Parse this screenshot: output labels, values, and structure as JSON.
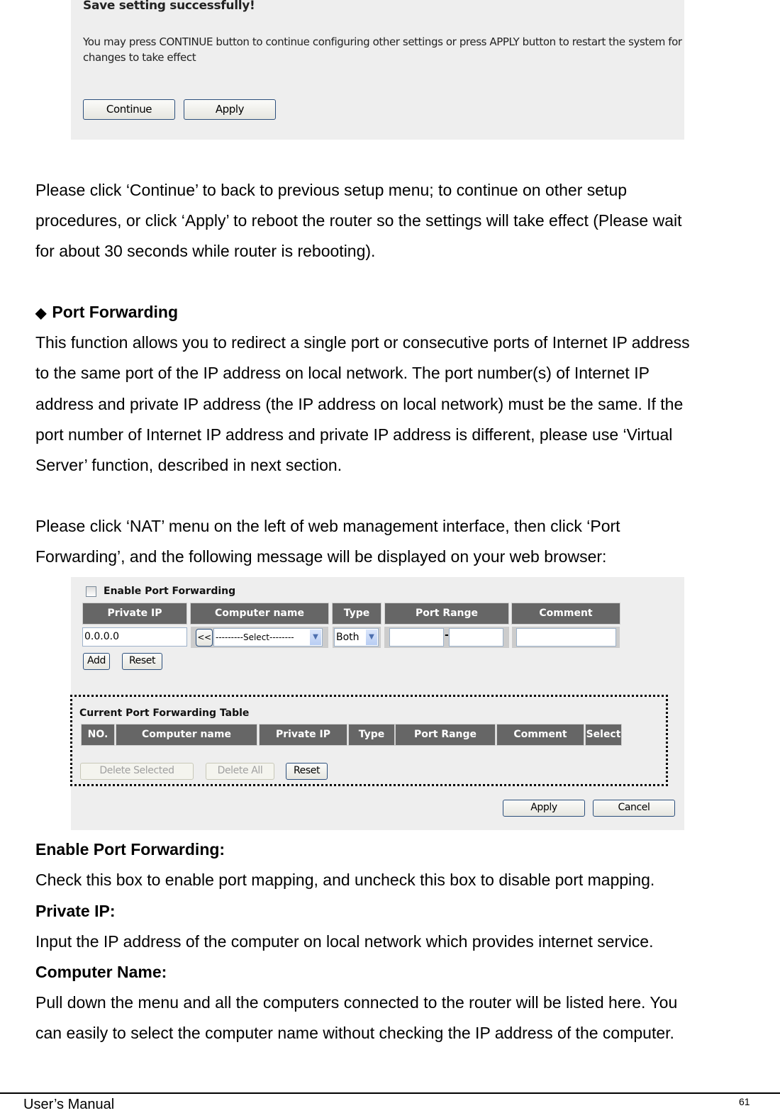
{
  "save_dialog": {
    "title": "Save setting successfully!",
    "message": "You may press CONTINUE button to continue configuring other settings or press APPLY button to restart the system for changes to take effect",
    "continue_label": "Continue",
    "apply_label": "Apply"
  },
  "paragraphs": {
    "continue_note": [
      "Please click ‘Continue’ to back to previous setup menu; to continue on other setup",
      "procedures, or click ‘Apply’ to reboot the router so the settings will take effect (Please wait",
      "for about 30 seconds while router is rebooting)."
    ],
    "section_title": "Port Forwarding",
    "section_bullet": "◆",
    "intro": [
      "This function allows you to redirect a single port or consecutive ports of Internet IP address",
      "to the same port of the IP address on local network. The port number(s) of Internet IP",
      "address and private IP address (the IP address on local network) must be the same. If the",
      "port number of Internet IP address and private IP address is different, please use ‘Virtual",
      "Server’ function, described in next section."
    ],
    "nav_instruction": [
      "Please click ‘NAT’ menu on the left of web management interface, then click ‘Port",
      "Forwarding’, and the following message will be displayed on your web browser:"
    ]
  },
  "port_forwarding_form": {
    "enable_label": "Enable Port Forwarding",
    "enable_checked": false,
    "headers": [
      "Private IP",
      "Computer name",
      "Type",
      "Port Range",
      "Comment"
    ],
    "private_ip_value": "0.0.0.0",
    "copy_button_label": "<<",
    "computer_select_value": "---------Select--------",
    "type_select_value": "Both",
    "port_range_start": "",
    "port_range_separator": "-",
    "port_range_end": "",
    "comment_value": "",
    "add_label": "Add",
    "reset_label": "Reset",
    "table_title": "Current Port Forwarding Table",
    "table_headers": [
      "NO.",
      "Computer name",
      "Private IP",
      "Type",
      "Port Range",
      "Comment",
      "Select"
    ],
    "delete_selected_label": "Delete Selected",
    "delete_all_label": "Delete All",
    "table_reset_label": "Reset",
    "apply_label": "Apply",
    "cancel_label": "Cancel"
  },
  "field_descriptions": [
    {
      "term": "Enable Port Forwarding:",
      "desc": [
        "Check this box to enable port mapping, and uncheck this box to disable port mapping."
      ]
    },
    {
      "term": "Private IP:",
      "desc": [
        "Input the IP address of the computer on local network which provides internet service."
      ]
    },
    {
      "term": "Computer Name:",
      "desc": [
        "Pull down the menu and all the computers connected to the router will be listed here. You",
        "can easily to select the computer name without checking the IP address of the computer."
      ]
    }
  ],
  "footer": {
    "left": "User’s Manual",
    "page_number": "61"
  }
}
